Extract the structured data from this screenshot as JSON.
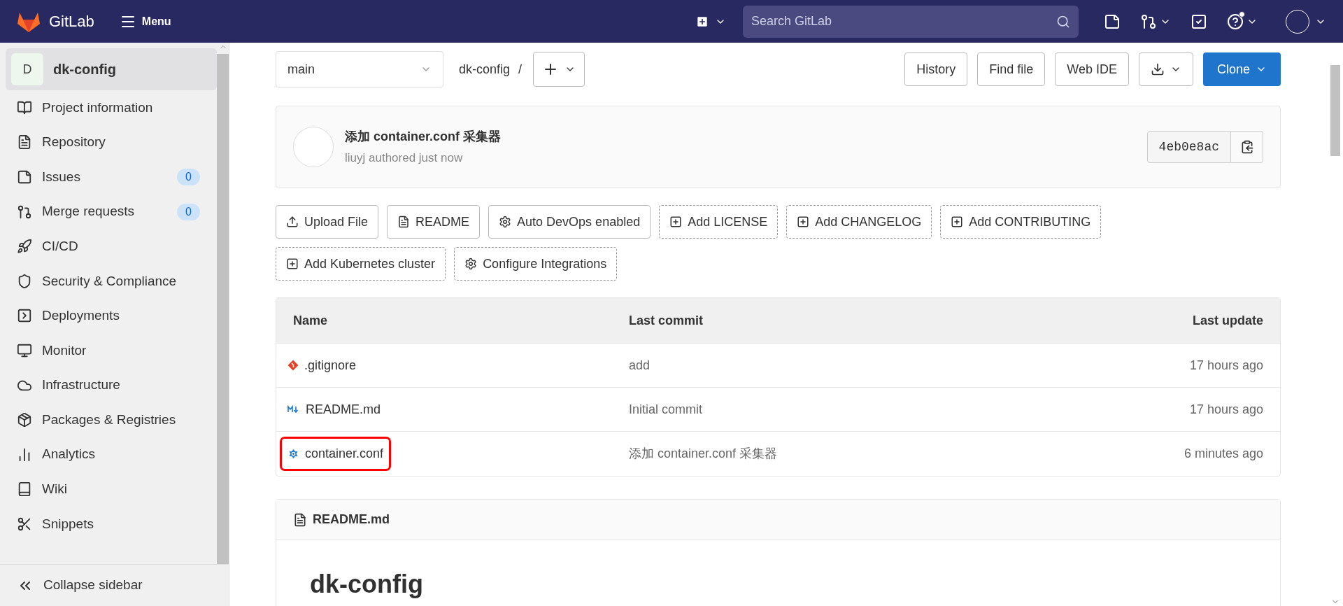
{
  "header": {
    "brand": "GitLab",
    "menu_label": "Menu",
    "search": {
      "placeholder": "Search GitLab"
    },
    "help_notification": true
  },
  "sidebar": {
    "project": {
      "avatar_letter": "D",
      "name": "dk-config"
    },
    "items": [
      {
        "label": "Project information"
      },
      {
        "label": "Repository"
      },
      {
        "label": "Issues",
        "badge": "0"
      },
      {
        "label": "Merge requests",
        "badge": "0"
      },
      {
        "label": "CI/CD"
      },
      {
        "label": "Security & Compliance"
      },
      {
        "label": "Deployments"
      },
      {
        "label": "Monitor"
      },
      {
        "label": "Infrastructure"
      },
      {
        "label": "Packages & Registries"
      },
      {
        "label": "Analytics"
      },
      {
        "label": "Wiki"
      },
      {
        "label": "Snippets"
      }
    ],
    "collapse_label": "Collapse sidebar"
  },
  "toolbar": {
    "branch": "main",
    "path": "dk-config",
    "separator": "/",
    "buttons": [
      "History",
      "Find file",
      "Web IDE"
    ],
    "clone_label": "Clone"
  },
  "commit": {
    "title": "添加 container.conf 采集器",
    "meta": "liuyj authored just now",
    "sha": "4eb0e8ac"
  },
  "actions": [
    {
      "label": "Upload File",
      "kind": "upload"
    },
    {
      "label": "README",
      "kind": "file"
    },
    {
      "label": "Auto DevOps enabled",
      "kind": "gear"
    },
    {
      "label": "Add LICENSE",
      "kind": "add"
    },
    {
      "label": "Add CHANGELOG",
      "kind": "add"
    },
    {
      "label": "Add CONTRIBUTING",
      "kind": "add"
    },
    {
      "label": "Add Kubernetes cluster",
      "kind": "add"
    },
    {
      "label": "Configure Integrations",
      "kind": "config"
    }
  ],
  "table": {
    "columns": [
      "Name",
      "Last commit",
      "Last update"
    ],
    "rows": [
      {
        "name": ".gitignore",
        "kind": "git",
        "commit": "add",
        "updated": "17 hours ago",
        "highlighted": false
      },
      {
        "name": "README.md",
        "kind": "markdown",
        "commit": "Initial commit",
        "updated": "17 hours ago",
        "highlighted": false
      },
      {
        "name": "container.conf",
        "kind": "config",
        "commit": "添加 container.conf 采集器",
        "updated": "6 minutes ago",
        "highlighted": true
      }
    ]
  },
  "readme": {
    "file": "README.md",
    "heading": "dk-config"
  }
}
